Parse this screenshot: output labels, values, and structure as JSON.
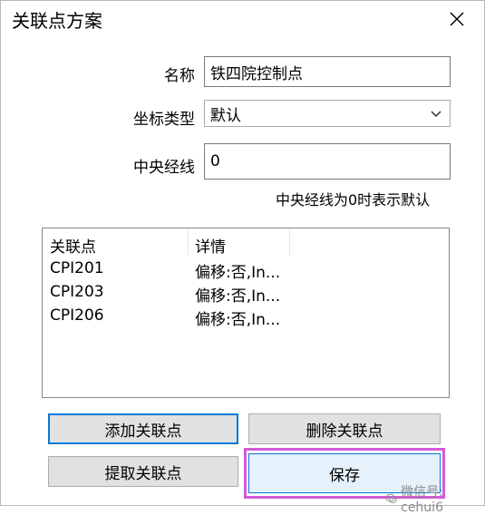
{
  "window": {
    "title": "关联点方案"
  },
  "form": {
    "name_label": "名称",
    "name_value": "铁四院控制点",
    "coord_label": "坐标类型",
    "coord_value": "默认",
    "meridian_label": "中央经线",
    "meridian_value": "0",
    "meridian_hint": "中央经线为0时表示默认"
  },
  "list": {
    "columns": [
      "关联点",
      "详情"
    ],
    "rows": [
      {
        "point": "CPI201",
        "detail": "偏移:否,In..."
      },
      {
        "point": "CPI203",
        "detail": "偏移:否,In..."
      },
      {
        "point": "CPI206",
        "detail": "偏移:否,In..."
      }
    ]
  },
  "buttons": {
    "add": "添加关联点",
    "delete": "删除关联点",
    "extract": "提取关联点",
    "save": "保存"
  },
  "watermark": {
    "text": "微信号: cehui6"
  },
  "colors": {
    "highlight": "#d25bd5",
    "focus": "#0078d7"
  }
}
